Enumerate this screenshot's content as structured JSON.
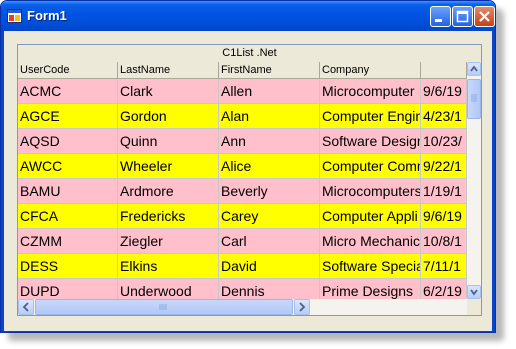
{
  "window": {
    "title": "Form1"
  },
  "grid": {
    "caption": "C1List .Net",
    "columns": [
      "UserCode",
      "LastName",
      "FirstName",
      "Company",
      ""
    ],
    "row_colors": {
      "odd": "#ffc0cb",
      "even": "#ffff00"
    },
    "rows": [
      [
        "ACMC",
        "Clark",
        "Allen",
        "Microcomputer",
        "9/6/19"
      ],
      [
        "AGCE",
        "Gordon",
        "Alan",
        "Computer Engin",
        "4/23/1"
      ],
      [
        "AQSD",
        "Quinn",
        "Ann",
        "Software Design",
        "10/23/"
      ],
      [
        "AWCC",
        "Wheeler",
        "Alice",
        "Computer Comm",
        "9/22/1"
      ],
      [
        "BAMU",
        "Ardmore",
        "Beverly",
        "Microcomputers",
        "1/19/1"
      ],
      [
        "CFCA",
        "Fredericks",
        "Carey",
        "Computer Appli",
        "9/6/19"
      ],
      [
        "CZMM",
        "Ziegler",
        "Carl",
        "Micro Mechanic",
        "10/8/1"
      ],
      [
        "DESS",
        "Elkins",
        "David",
        "Software Specia",
        "7/11/1"
      ],
      [
        "DUPD",
        "Underwood",
        "Dennis",
        "Prime Designs",
        "6/2/19"
      ]
    ]
  }
}
